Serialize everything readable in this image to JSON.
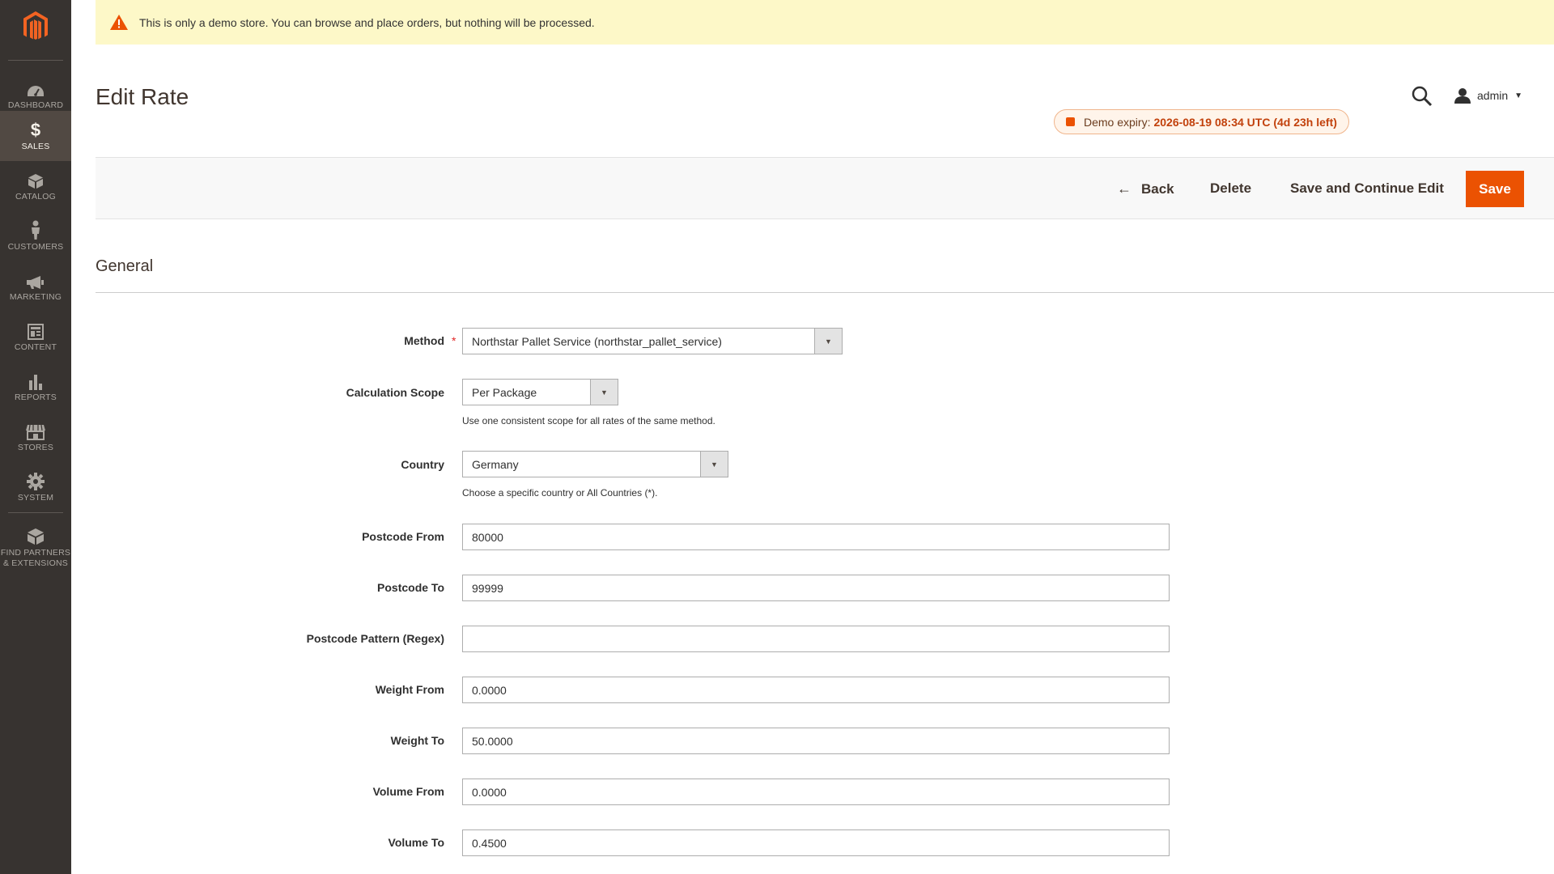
{
  "notice": {
    "text": "This is only a demo store. You can browse and place orders, but nothing will be processed."
  },
  "sidebar": {
    "items": [
      {
        "label": "Dashboard",
        "icon": "dashboard-icon"
      },
      {
        "label": "Sales",
        "icon": "dollar-icon",
        "active": true
      },
      {
        "label": "Catalog",
        "icon": "box-icon"
      },
      {
        "label": "Customers",
        "icon": "person-icon"
      },
      {
        "label": "Marketing",
        "icon": "megaphone-icon"
      },
      {
        "label": "Content",
        "icon": "layout-icon"
      },
      {
        "label": "Reports",
        "icon": "bar-chart-icon"
      },
      {
        "label": "Stores",
        "icon": "storefront-icon"
      },
      {
        "label": "System",
        "icon": "gear-icon"
      },
      {
        "label_line1": "Find Partners",
        "label_line2": "& Extensions",
        "icon": "cube-icon"
      }
    ]
  },
  "header": {
    "title": "Edit Rate",
    "user": "admin",
    "expiry_label": "Demo expiry:",
    "expiry_value": "2026-08-19 08:34 UTC (4d 23h left)"
  },
  "actions": {
    "back": "Back",
    "delete": "Delete",
    "save_continue": "Save and Continue Edit",
    "save": "Save"
  },
  "section": {
    "title": "General"
  },
  "form": {
    "method": {
      "label": "Method",
      "value": "Northstar Pallet Service (northstar_pallet_service)"
    },
    "calc_scope": {
      "label": "Calculation Scope",
      "value": "Per Package",
      "note": "Use one consistent scope for all rates of the same method."
    },
    "country": {
      "label": "Country",
      "value": "Germany",
      "note": "Choose a specific country or All Countries (*)."
    },
    "postcode_from": {
      "label": "Postcode From",
      "value": "80000"
    },
    "postcode_to": {
      "label": "Postcode To",
      "value": "99999"
    },
    "postcode_pattern": {
      "label": "Postcode Pattern (Regex)",
      "value": ""
    },
    "weight_from": {
      "label": "Weight From",
      "value": "0.0000"
    },
    "weight_to": {
      "label": "Weight To",
      "value": "50.0000"
    },
    "volume_from": {
      "label": "Volume From",
      "value": "0.0000"
    },
    "volume_to": {
      "label": "Volume To",
      "value": "0.4500"
    }
  },
  "colors": {
    "accent": "#eb5202",
    "sidebar": "#373330",
    "notice_bg": "#fdf8c8"
  }
}
